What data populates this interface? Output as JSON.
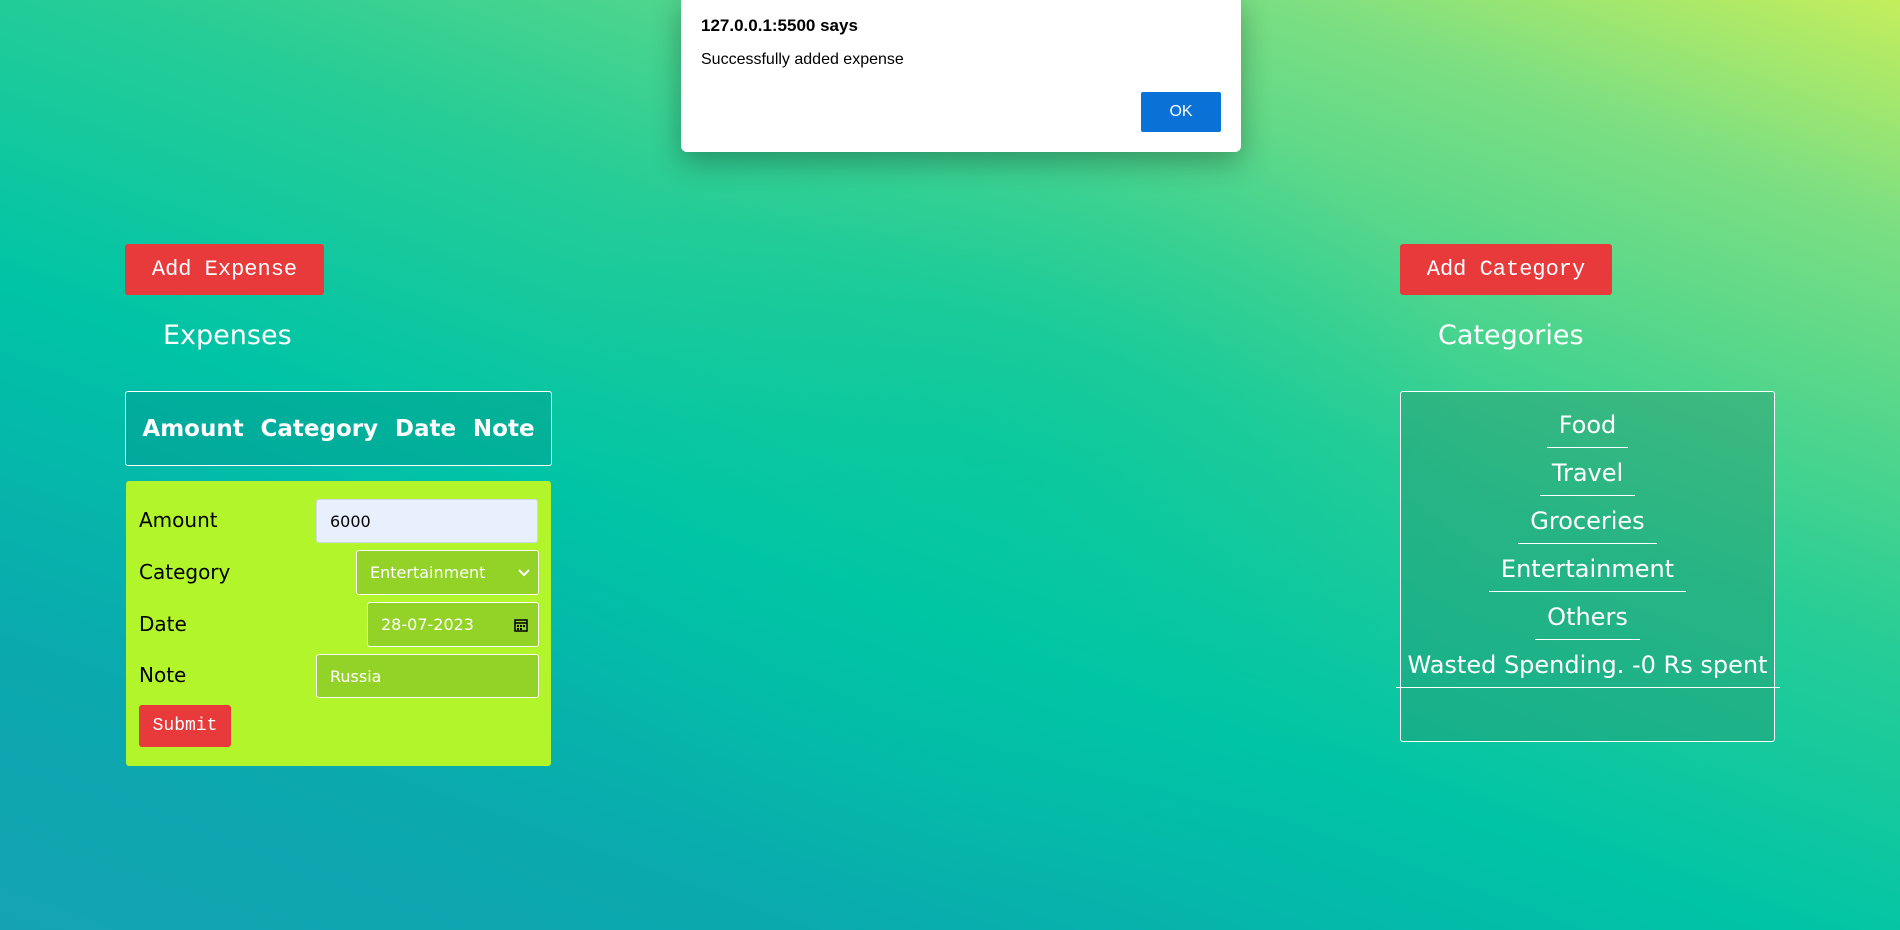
{
  "alert": {
    "title": "127.0.0.1:5500 says",
    "message": "Successfully added expense",
    "ok_label": "OK"
  },
  "expenses": {
    "add_button": "Add Expense",
    "title": "Expenses",
    "columns": [
      "Amount",
      "Category",
      "Date",
      "Note"
    ],
    "form": {
      "amount_label": "Amount",
      "amount_value": "6000",
      "category_label": "Category",
      "category_value": "Entertainment",
      "date_label": "Date",
      "date_value": "28-07-2023",
      "note_label": "Note",
      "note_value": "Russia",
      "submit_label": "Submit"
    }
  },
  "categories": {
    "add_button": "Add Category",
    "title": "Categories",
    "items": [
      "Food",
      "Travel",
      "Groceries",
      "Entertainment",
      "Others",
      "Wasted Spending. -0 Rs spent"
    ]
  },
  "colors": {
    "button_red": "#e8393b",
    "form_bg": "#b2f52a",
    "alert_ok_blue": "#0a72d6"
  }
}
